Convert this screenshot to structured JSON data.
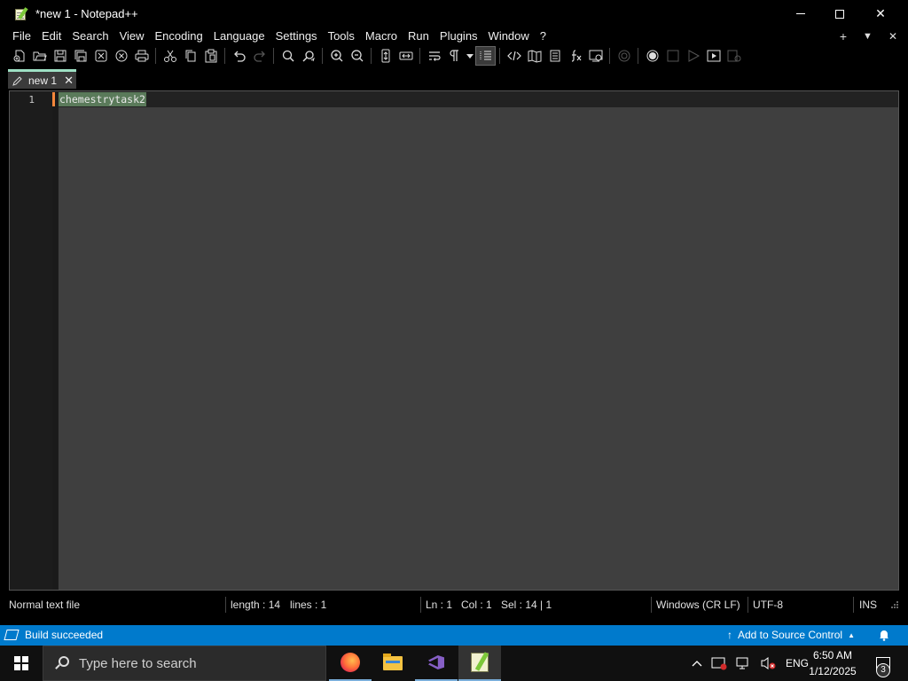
{
  "window": {
    "title": "*new 1 - Notepad++",
    "minimize_glyph": "",
    "close_glyph": "✕"
  },
  "menu": {
    "items": [
      "File",
      "Edit",
      "Search",
      "View",
      "Encoding",
      "Language",
      "Settings",
      "Tools",
      "Macro",
      "Run",
      "Plugins",
      "Window",
      "?"
    ],
    "right": {
      "add": "+",
      "dropdown": "▼",
      "close": "✕"
    }
  },
  "toolbar": {
    "icons": [
      "new-file-icon",
      "open-file-icon",
      "save-icon",
      "save-all-icon",
      "close-icon",
      "close-all-icon",
      "print-icon",
      "cut-icon",
      "copy-icon",
      "paste-icon",
      "undo-icon",
      "redo-icon",
      "find-icon",
      "replace-icon",
      "zoom-in-icon",
      "zoom-out-icon",
      "sync-vertical-icon",
      "sync-horizontal-icon",
      "word-wrap-icon",
      "show-all-chars-icon",
      "indent-guide-icon",
      "xml-tag-icon",
      "document-map-icon",
      "document-list-icon",
      "function-list-icon",
      "folder-workspace-icon",
      "monitoring-icon",
      "record-macro-icon",
      "stop-macro-icon",
      "play-macro-icon",
      "run-macro-multiple-icon",
      "save-macro-icon"
    ]
  },
  "tab": {
    "label": "new 1",
    "close": "✕"
  },
  "editor": {
    "line_number": "1",
    "text": "chemestrytask2"
  },
  "status": {
    "file_type": "Normal text file",
    "length": "length : 14",
    "lines": "lines : 1",
    "ln": "Ln : 1",
    "col": "Col : 1",
    "sel": "Sel : 14 | 1",
    "eol": "Windows (CR LF)",
    "encoding": "UTF-8",
    "mode": "INS"
  },
  "vs_bar": {
    "build_status": "Build succeeded",
    "source_control": "Add to Source Control",
    "source_arrow": "↑",
    "caret": "▲"
  },
  "taskbar": {
    "search_placeholder": "Type here to search",
    "apps": [
      "Firefox",
      "File Explorer",
      "Visual Studio",
      "Notepad++"
    ],
    "tray": {
      "chevron": "︿",
      "language": "ENG",
      "time": "6:50 AM",
      "date": "1/12/2025",
      "notifications": "3"
    }
  },
  "colors": {
    "accent": "#007acc",
    "tab_indicator": "#9ee0c4",
    "change_marker": "#f4873b"
  }
}
